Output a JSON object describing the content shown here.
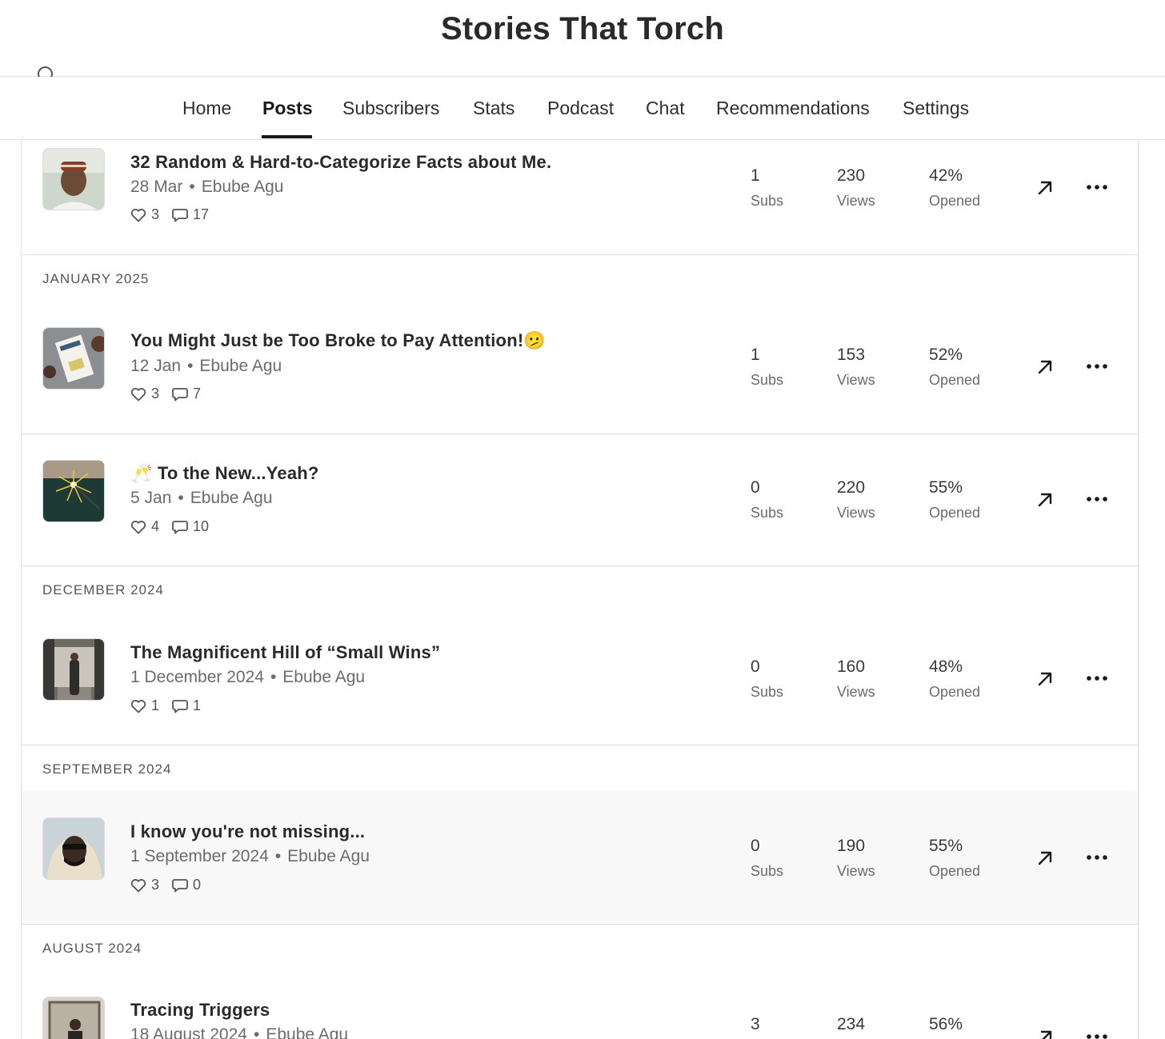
{
  "site": {
    "title": "Stories That Torch"
  },
  "nav": {
    "items": [
      "Home",
      "Posts",
      "Subscribers",
      "Stats",
      "Podcast",
      "Chat",
      "Recommendations",
      "Settings"
    ],
    "active": "Posts"
  },
  "sections": {
    "jan2025": "JANUARY 2025",
    "dec2024": "DECEMBER 2024",
    "sep2024": "SEPTEMBER 2024",
    "aug2024": "AUGUST 2024"
  },
  "stat_labels": {
    "subs": "Subs",
    "views": "Views",
    "opened": "Opened"
  },
  "posts": [
    {
      "title": "32 Random & Hard-to-Categorize Facts about Me.",
      "date": "28 Mar",
      "author": "Ebube Agu",
      "likes": "3",
      "comments": "17",
      "subs": "1",
      "views": "230",
      "opened": "42%"
    },
    {
      "title": "You Might Just be Too Broke to Pay Attention!",
      "title_emoji": "🫤",
      "date": "12 Jan",
      "author": "Ebube Agu",
      "likes": "3",
      "comments": "7",
      "subs": "1",
      "views": "153",
      "opened": "52%"
    },
    {
      "title_emoji": "🥂",
      "title": "To the New...Yeah?",
      "date": "5 Jan",
      "author": "Ebube Agu",
      "likes": "4",
      "comments": "10",
      "subs": "0",
      "views": "220",
      "opened": "55%"
    },
    {
      "title": "The Magnificent Hill of “Small Wins”",
      "date": "1 December 2024",
      "author": "Ebube Agu",
      "likes": "1",
      "comments": "1",
      "subs": "0",
      "views": "160",
      "opened": "48%"
    },
    {
      "title": "I know you're not missing...",
      "date": "1 September 2024",
      "author": "Ebube Agu",
      "likes": "3",
      "comments": "0",
      "subs": "0",
      "views": "190",
      "opened": "55%"
    },
    {
      "title": "Tracing Triggers",
      "date": "18 August 2024",
      "author": "Ebube Agu",
      "subs": "3",
      "views": "234",
      "opened": "56%"
    }
  ],
  "icons": [
    "search-icon",
    "heart-icon",
    "comment-icon",
    "open-external-icon",
    "more-options-icon"
  ]
}
